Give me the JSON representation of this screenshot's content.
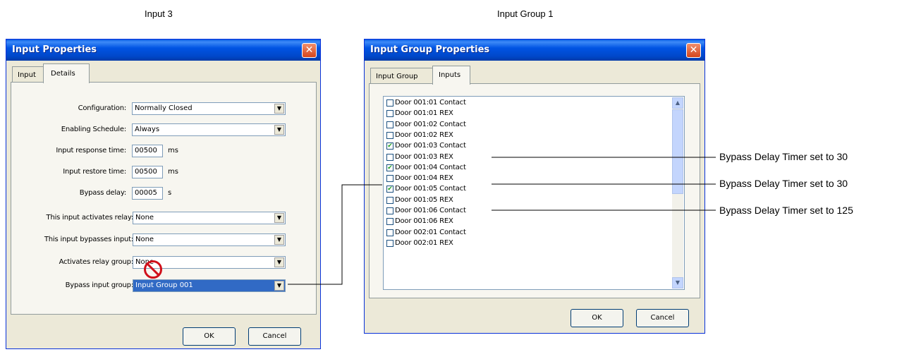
{
  "captions": {
    "left": "Input 3",
    "right": "Input Group 1"
  },
  "input_properties": {
    "title": "Input Properties",
    "close_glyph": "✕",
    "tabs": [
      "Input",
      "Details"
    ],
    "fields": {
      "configuration": {
        "label": "Configuration:",
        "value": "Normally Closed"
      },
      "enabling_schedule": {
        "label": "Enabling Schedule:",
        "value": "Always"
      },
      "input_response_time": {
        "label": "Input response time:",
        "value": "00500",
        "unit": "ms"
      },
      "input_restore_time": {
        "label": "Input restore time:",
        "value": "00500",
        "unit": "ms"
      },
      "bypass_delay": {
        "label": "Bypass delay:",
        "value": "00005",
        "unit": "s"
      },
      "activates_relay": {
        "label": "This input activates relay:",
        "value": "None"
      },
      "bypasses_input": {
        "label": "This input bypasses input:",
        "value": "None"
      },
      "activates_relay_group": {
        "label": "Activates relay group:",
        "value": "None"
      },
      "bypass_input_group": {
        "label": "Bypass input group:",
        "value": "Input Group 001"
      }
    },
    "ok_label": "OK",
    "cancel_label": "Cancel"
  },
  "input_group_properties": {
    "title": "Input Group Properties",
    "close_glyph": "✕",
    "tabs": [
      "Input Group",
      "Inputs"
    ],
    "items": [
      {
        "label": "Door 001:01 Contact",
        "checked": false
      },
      {
        "label": "Door 001:01 REX",
        "checked": false
      },
      {
        "label": "Door 001:02 Contact",
        "checked": false
      },
      {
        "label": "Door 001:02 REX",
        "checked": false
      },
      {
        "label": "Door 001:03 Contact",
        "checked": true
      },
      {
        "label": "Door 001:03 REX",
        "checked": false
      },
      {
        "label": "Door 001:04 Contact",
        "checked": true
      },
      {
        "label": "Door 001:04 REX",
        "checked": false
      },
      {
        "label": "Door 001:05 Contact",
        "checked": true
      },
      {
        "label": "Door 001:05 REX",
        "checked": false
      },
      {
        "label": "Door 001:06 Contact",
        "checked": false
      },
      {
        "label": "Door 001:06 REX",
        "checked": false
      },
      {
        "label": "Door 002:01 Contact",
        "checked": false
      },
      {
        "label": "Door 002:01 REX",
        "checked": false
      }
    ],
    "ok_label": "OK",
    "cancel_label": "Cancel"
  },
  "annotations": [
    "Bypass Delay Timer set to 30",
    "Bypass Delay Timer set to 30",
    "Bypass Delay Timer set to 125"
  ],
  "colors": {
    "prohibited_sign": "#d0101a",
    "title_bar": "#0054e3",
    "selection": "#316ac5"
  }
}
